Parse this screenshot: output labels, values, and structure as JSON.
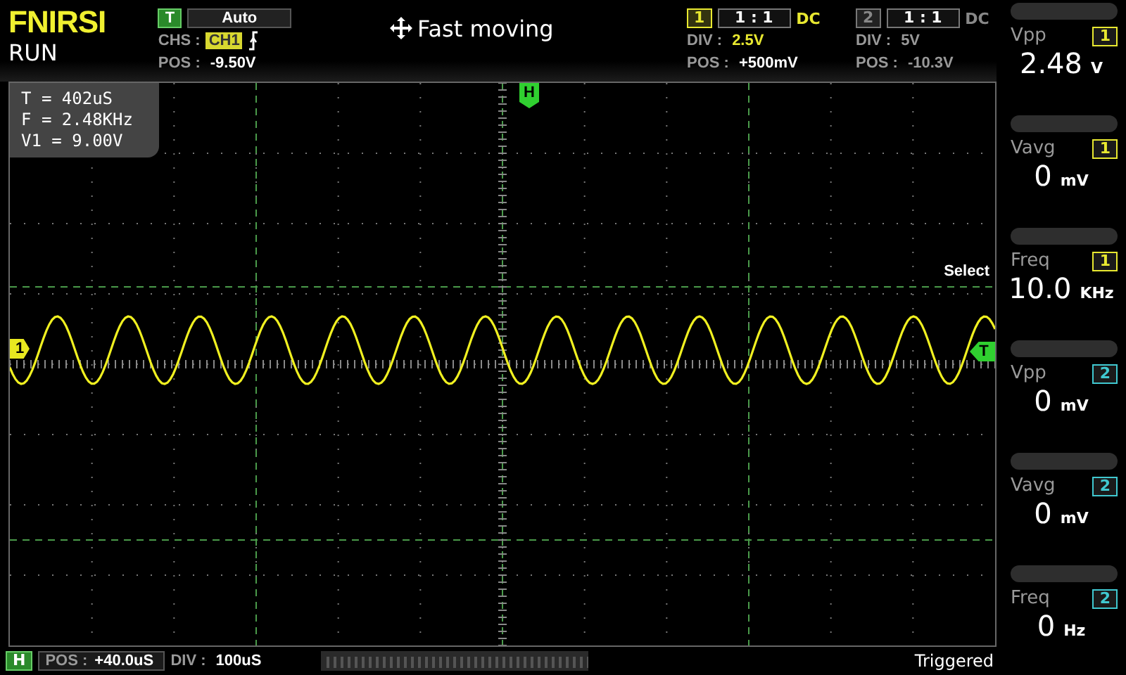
{
  "brand": "FNIRSI",
  "run_state": "RUN",
  "trigger": {
    "badge": "T",
    "mode": "Auto",
    "source_label": "CHS :",
    "source": "CH1",
    "pos_label": "POS :",
    "pos": "-9.50V"
  },
  "title": "Fast moving",
  "channels": [
    {
      "number": "1",
      "probe": "1 : 1",
      "coupling": "DC",
      "div_label": "DIV :",
      "div": "2.5V",
      "pos_label": "POS :",
      "pos": "+500mV",
      "enabled": true
    },
    {
      "number": "2",
      "probe": "1 : 1",
      "coupling": "DC",
      "div_label": "DIV :",
      "div": "5V",
      "pos_label": "POS :",
      "pos": "-10.3V",
      "enabled": false
    }
  ],
  "cursor_info": [
    "T = 402uS",
    "F = 2.48KHz",
    "V1 = 9.00V"
  ],
  "markers": {
    "channel": "1",
    "horizontal": "H",
    "trigger": "T"
  },
  "select_label": "Select",
  "measurements": [
    {
      "label": "Vpp",
      "channel": "1",
      "color": "#e8e830",
      "value": "2.48",
      "unit": "V"
    },
    {
      "label": "Vavg",
      "channel": "1",
      "color": "#e8e830",
      "value": "0",
      "unit": "mV"
    },
    {
      "label": "Freq",
      "channel": "1",
      "color": "#e8e830",
      "value": "10.0",
      "unit": "KHz"
    },
    {
      "label": "Vpp",
      "channel": "2",
      "color": "#40c8d0",
      "value": "0",
      "unit": "mV"
    },
    {
      "label": "Vavg",
      "channel": "2",
      "color": "#40c8d0",
      "value": "0",
      "unit": "mV"
    },
    {
      "label": "Freq",
      "channel": "2",
      "color": "#40c8d0",
      "value": "0",
      "unit": "Hz"
    }
  ],
  "timebase": {
    "badge": "H",
    "pos_label": "POS :",
    "pos": "+40.0uS",
    "div_label": "DIV :",
    "div": "100uS"
  },
  "status": "Triggered"
}
